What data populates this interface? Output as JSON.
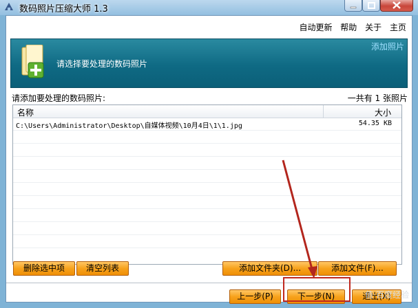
{
  "window": {
    "title": "数码照片压缩大师 1.3"
  },
  "menu": {
    "auto_update": "自动更新",
    "help": "帮助",
    "about": "关于",
    "home": "主页"
  },
  "banner": {
    "instruction": "请选择要处理的数码照片",
    "link": "添加照片"
  },
  "list": {
    "label": "请添加要处理的数码照片:",
    "count_text": "一共有 1 张照片",
    "columns": {
      "name": "名称",
      "size": "大小"
    },
    "rows": [
      {
        "path": "C:\\Users\\Administrator\\Desktop\\自媒体视频\\10月4日\\1\\1.jpg",
        "size": "54.35 KB"
      }
    ]
  },
  "buttons": {
    "delete_selected": "删除选中项",
    "clear_list": "清空列表",
    "add_folder": "添加文件夹(D)...",
    "add_file": "添加文件(F)...",
    "prev": "上一步(P)",
    "next": "下一步(N)",
    "exit": "退出(X)"
  },
  "colors": {
    "banner": "#0f6a84",
    "button": "#f7a21c",
    "highlight": "#c0281f"
  },
  "watermark": "值·百度经验"
}
